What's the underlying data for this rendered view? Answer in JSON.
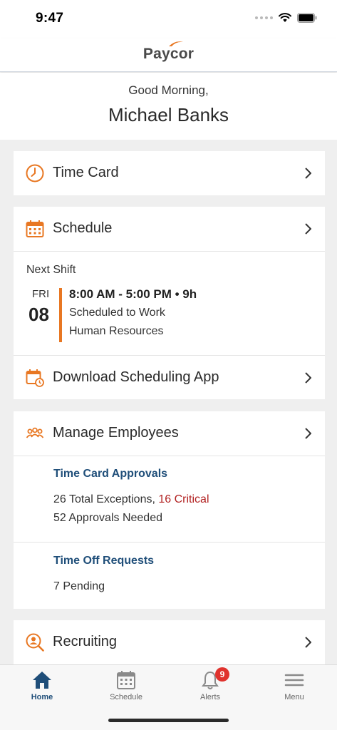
{
  "status_bar": {
    "time": "9:47"
  },
  "header": {
    "logo_text": "Paycor"
  },
  "greeting": {
    "salutation": "Good Morning,",
    "user_name": "Michael Banks"
  },
  "time_card": {
    "label": "Time Card"
  },
  "schedule": {
    "label": "Schedule",
    "next_shift_label": "Next Shift",
    "day": "FRI",
    "date": "08",
    "time": "8:00 AM - 5:00 PM • 9h",
    "status": "Scheduled to Work",
    "department": "Human Resources",
    "download_label": "Download Scheduling App"
  },
  "manage_employees": {
    "label": "Manage Employees",
    "time_card_approvals": {
      "title": "Time Card Approvals",
      "total_exceptions": "26 Total Exceptions, ",
      "critical": "16 Critical",
      "approvals_needed": "52 Approvals Needed"
    },
    "time_off_requests": {
      "title": "Time Off Requests",
      "pending": "7 Pending"
    }
  },
  "recruiting": {
    "label": "Recruiting"
  },
  "tabbar": {
    "home": "Home",
    "schedule": "Schedule",
    "alerts": "Alerts",
    "alerts_badge": "9",
    "menu": "Menu"
  },
  "colors": {
    "accent": "#e87722",
    "navy": "#1f4e79",
    "critical": "#b22222",
    "badge": "#e0322d"
  },
  "icons": [
    "clock-icon",
    "calendar-icon",
    "calendar-clock-icon",
    "people-icon",
    "search-person-icon",
    "chevron-right-icon",
    "home-icon",
    "bell-icon",
    "hamburger-icon",
    "wifi-icon",
    "battery-icon"
  ]
}
